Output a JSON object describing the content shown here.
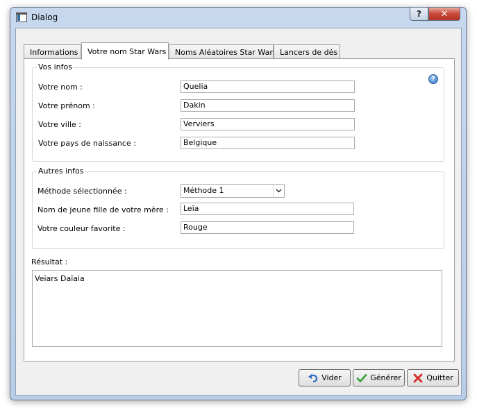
{
  "window": {
    "title": "Dialog",
    "help_glyph": "?",
    "close_glyph": "✕"
  },
  "tabs": [
    {
      "label": "Informations",
      "active": false
    },
    {
      "label": "Votre nom Star Wars",
      "active": true
    },
    {
      "label": "Noms Aléatoires Star Wars",
      "active": false
    },
    {
      "label": "Lancers de dés",
      "active": false
    }
  ],
  "vos_infos": {
    "title": "Vos infos",
    "help_icon": "help-icon",
    "fields": [
      {
        "label": "Votre nom :",
        "value": "Quelia"
      },
      {
        "label": "Votre prénom :",
        "value": "Dakin"
      },
      {
        "label": "Votre ville :",
        "value": "Verviers"
      },
      {
        "label": "Votre pays de naissance :",
        "value": "Belgique"
      }
    ]
  },
  "autres_infos": {
    "title": "Autres infos",
    "method_label": "Méthode sélectionnée :",
    "method_value": "Méthode 1",
    "mother_label": "Nom de jeune fille de votre mère :",
    "mother_value": "Leïa",
    "color_label": "Votre couleur favorite :",
    "color_value": "Rouge"
  },
  "resultat": {
    "label": "Résultat :",
    "value": "Veïars Daïaia"
  },
  "buttons": {
    "clear": "Vider",
    "generate": "Générer",
    "quit": "Quitter"
  },
  "colors": {
    "undo_icon": "#2d6ec2",
    "check_icon": "#2f9e2f",
    "cross_icon": "#d42a2a",
    "close_button": "#c8473a"
  }
}
